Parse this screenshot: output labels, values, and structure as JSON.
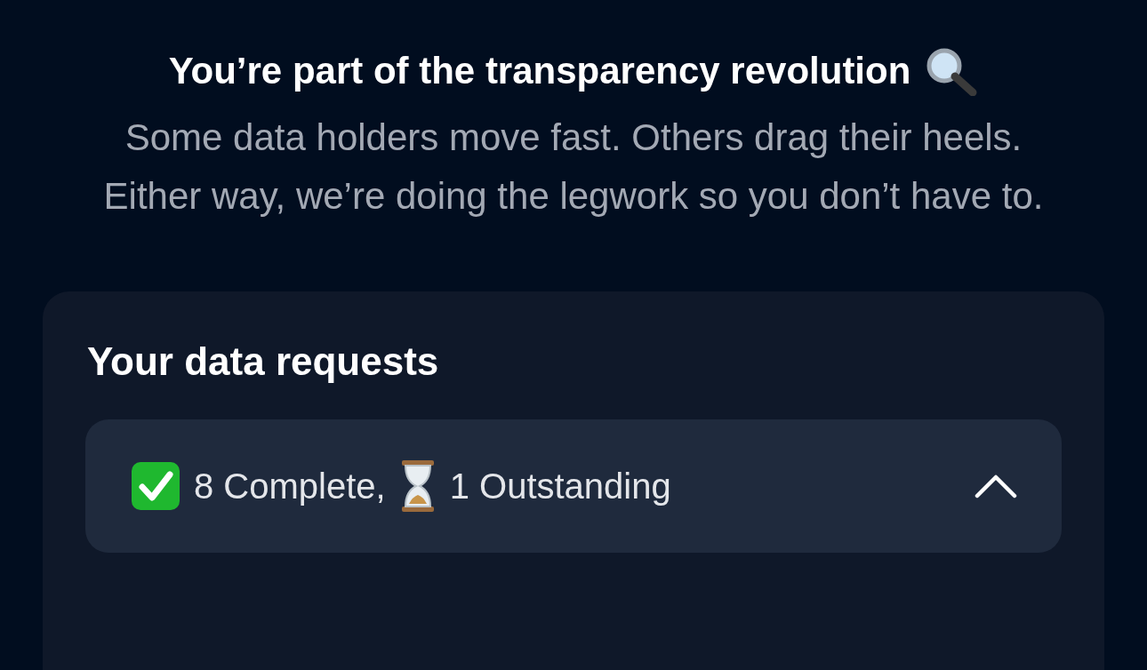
{
  "header": {
    "title": "You’re part of the transparency revolution",
    "subtitle": "Some data holders move fast. Others drag their heels. Either way, we’re doing the legwork so you don’t have to."
  },
  "requests_card": {
    "heading": "Your data requests",
    "summary": {
      "expanded": true,
      "parts": [
        {
          "kind": "complete",
          "label": "8 Complete,"
        },
        {
          "kind": "outstanding",
          "label": "1 Outstanding"
        }
      ]
    }
  }
}
